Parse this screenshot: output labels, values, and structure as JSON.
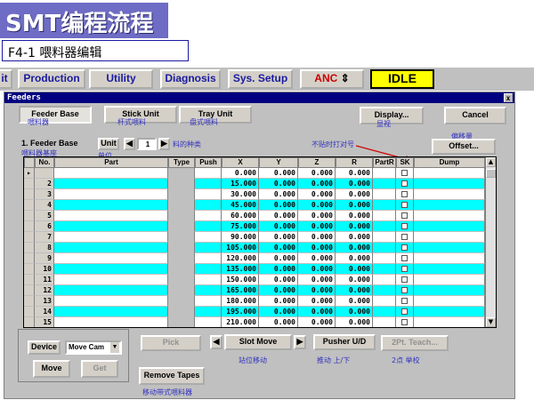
{
  "slide": {
    "title": "SMT编程流程",
    "subtitle": "F4-1  喂料器编辑"
  },
  "menubar": {
    "items": [
      "it",
      "Production",
      "Utility",
      "Diagnosis",
      "Sys. Setup"
    ],
    "anc_label": "ANC",
    "status": "IDLE"
  },
  "window": {
    "title": "Feeders",
    "close": "x"
  },
  "tabs": [
    {
      "label": "Feeder Base",
      "note": "喂料器"
    },
    {
      "label": "Stick Unit",
      "note": "杆式喂料"
    },
    {
      "label": "Tray Unit",
      "note": "盘式喂料"
    }
  ],
  "display_button": {
    "label": "Display...",
    "note": "显视"
  },
  "cancel_button": "Cancel",
  "section": {
    "label": "1. Feeder Base",
    "note": "喂料器基座"
  },
  "unit": {
    "label": "Unit",
    "value": "1",
    "note": "单位",
    "type_note": "料的种类"
  },
  "offset": {
    "label": "Offset...",
    "note": "偏移量"
  },
  "skip_note": "不贴时打对号",
  "table": {
    "headers": [
      "No.",
      "Part",
      "Type",
      "Push",
      "X",
      "Y",
      "Z",
      "R",
      "PartR",
      "SK",
      "Dump"
    ],
    "rows": [
      {
        "no": "",
        "x": "0.000",
        "y": "0.000",
        "z": "0.000",
        "r": "0.000"
      },
      {
        "no": "2",
        "x": "15.000",
        "y": "0.000",
        "z": "0.000",
        "r": "0.000"
      },
      {
        "no": "3",
        "x": "30.000",
        "y": "0.000",
        "z": "0.000",
        "r": "0.000"
      },
      {
        "no": "4",
        "x": "45.000",
        "y": "0.000",
        "z": "0.000",
        "r": "0.000"
      },
      {
        "no": "5",
        "x": "60.000",
        "y": "0.000",
        "z": "0.000",
        "r": "0.000"
      },
      {
        "no": "6",
        "x": "75.000",
        "y": "0.000",
        "z": "0.000",
        "r": "0.000"
      },
      {
        "no": "7",
        "x": "90.000",
        "y": "0.000",
        "z": "0.000",
        "r": "0.000"
      },
      {
        "no": "8",
        "x": "105.000",
        "y": "0.000",
        "z": "0.000",
        "r": "0.000"
      },
      {
        "no": "9",
        "x": "120.000",
        "y": "0.000",
        "z": "0.000",
        "r": "0.000"
      },
      {
        "no": "10",
        "x": "135.000",
        "y": "0.000",
        "z": "0.000",
        "r": "0.000"
      },
      {
        "no": "11",
        "x": "150.000",
        "y": "0.000",
        "z": "0.000",
        "r": "0.000"
      },
      {
        "no": "12",
        "x": "165.000",
        "y": "0.000",
        "z": "0.000",
        "r": "0.000"
      },
      {
        "no": "13",
        "x": "180.000",
        "y": "0.000",
        "z": "0.000",
        "r": "0.000"
      },
      {
        "no": "14",
        "x": "195.000",
        "y": "0.000",
        "z": "0.000",
        "r": "0.000"
      },
      {
        "no": "15",
        "x": "210.000",
        "y": "0.000",
        "z": "0.000",
        "r": "0.000"
      }
    ]
  },
  "device": {
    "label": "Device",
    "value": "Move Cam"
  },
  "move_button": "Move",
  "get_button": "Get",
  "pick_button": "Pick",
  "slot_move": {
    "label": "Slot Move",
    "note": "站位移动"
  },
  "pusher": {
    "label": "Pusher U/D",
    "note": "推动 上/下"
  },
  "teach": {
    "label": "2Pt. Teach...",
    "note": "2点 举校"
  },
  "remove_tapes": {
    "label": "Remove Tapes",
    "note": "移动带式喂料器"
  },
  "colors": {
    "accent": "#6e6cc4",
    "row_cyan": "#00ffff",
    "title_bar": "#000080",
    "idle": "#ffff00"
  }
}
